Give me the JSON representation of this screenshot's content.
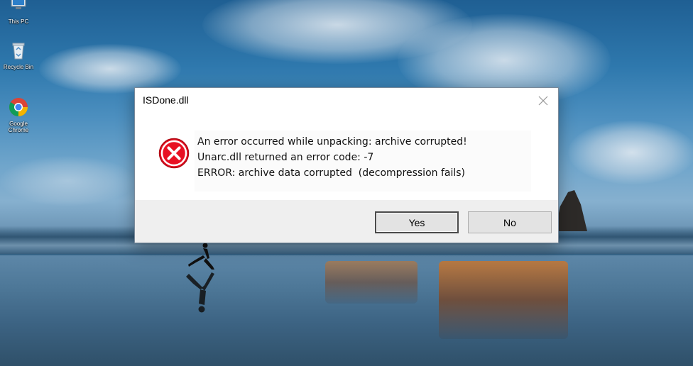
{
  "desktop": {
    "icons": [
      {
        "label": "This PC",
        "icon": "computer-icon"
      },
      {
        "label": "Recycle Bin",
        "icon": "recycle-bin-icon"
      },
      {
        "label": "Google Chrome",
        "icon": "chrome-icon"
      }
    ]
  },
  "dialog": {
    "title": "ISDone.dll",
    "close_icon": "close-icon",
    "status_icon": "error-icon",
    "error_color": "#d4151c",
    "messages": [
      "An error occurred while unpacking: archive corrupted!",
      "Unarc.dll returned an error code: -7",
      "ERROR: archive data corrupted  (decompression fails)"
    ],
    "buttons": {
      "yes": "Yes",
      "no": "No"
    }
  }
}
